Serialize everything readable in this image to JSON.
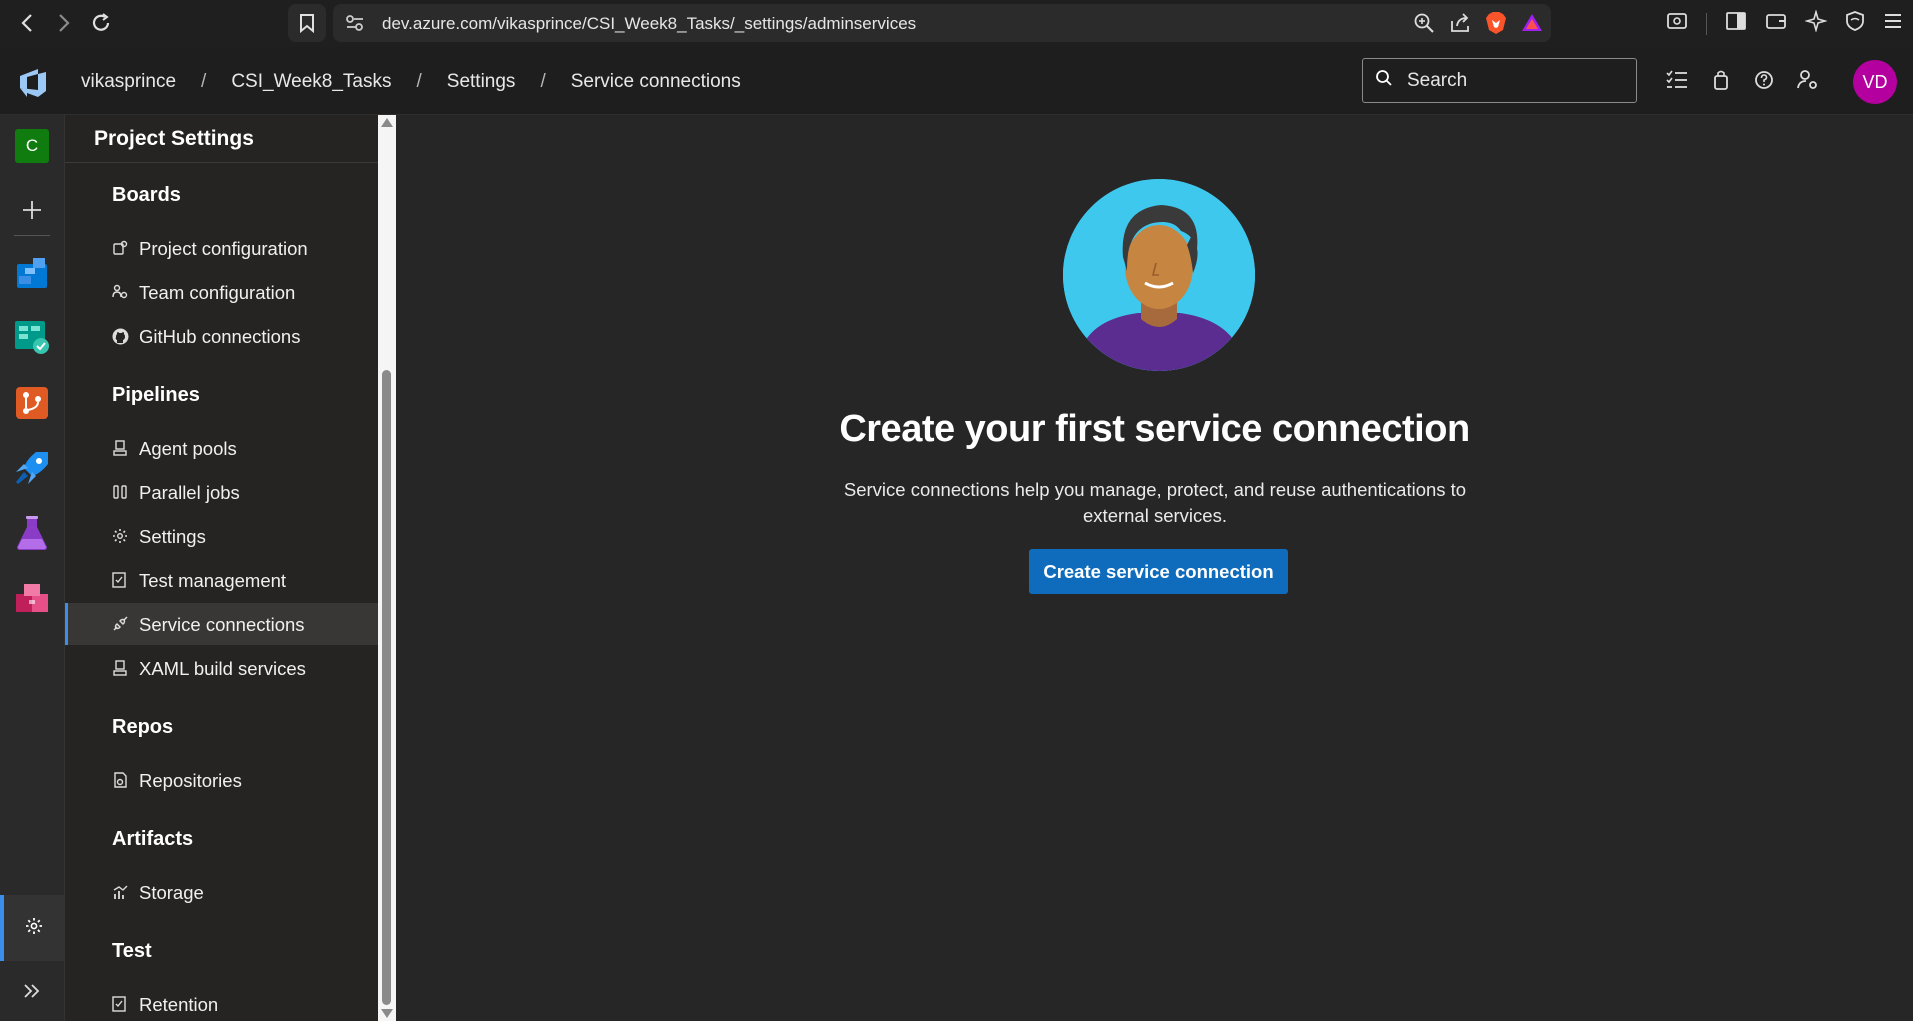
{
  "browser": {
    "url": "dev.azure.com/vikasprince/CSI_Week8_Tasks/_settings/adminservices"
  },
  "header": {
    "breadcrumbs": [
      "vikasprince",
      "CSI_Week8_Tasks",
      "Settings",
      "Service connections"
    ],
    "search_placeholder": "Search",
    "avatar_initials": "VD"
  },
  "rail": {
    "project_initial": "C"
  },
  "settings_panel": {
    "title": "Project Settings",
    "sections": [
      {
        "heading": "Boards",
        "items": [
          "Project configuration",
          "Team configuration",
          "GitHub connections"
        ]
      },
      {
        "heading": "Pipelines",
        "items": [
          "Agent pools",
          "Parallel jobs",
          "Settings",
          "Test management",
          "Service connections",
          "XAML build services"
        ]
      },
      {
        "heading": "Repos",
        "items": [
          "Repositories"
        ]
      },
      {
        "heading": "Artifacts",
        "items": [
          "Storage"
        ]
      },
      {
        "heading": "Test",
        "items": [
          "Retention"
        ]
      }
    ],
    "selected_item": "Service connections"
  },
  "main": {
    "title": "Create your first service connection",
    "description": "Service connections help you manage, protect, and reuse authentications to external services.",
    "button_label": "Create service connection"
  },
  "colors": {
    "accent": "#0f6cbd",
    "selected_indicator": "#3b8eea",
    "avatar_bg": "#b4009e",
    "project_badge": "#107c10"
  }
}
